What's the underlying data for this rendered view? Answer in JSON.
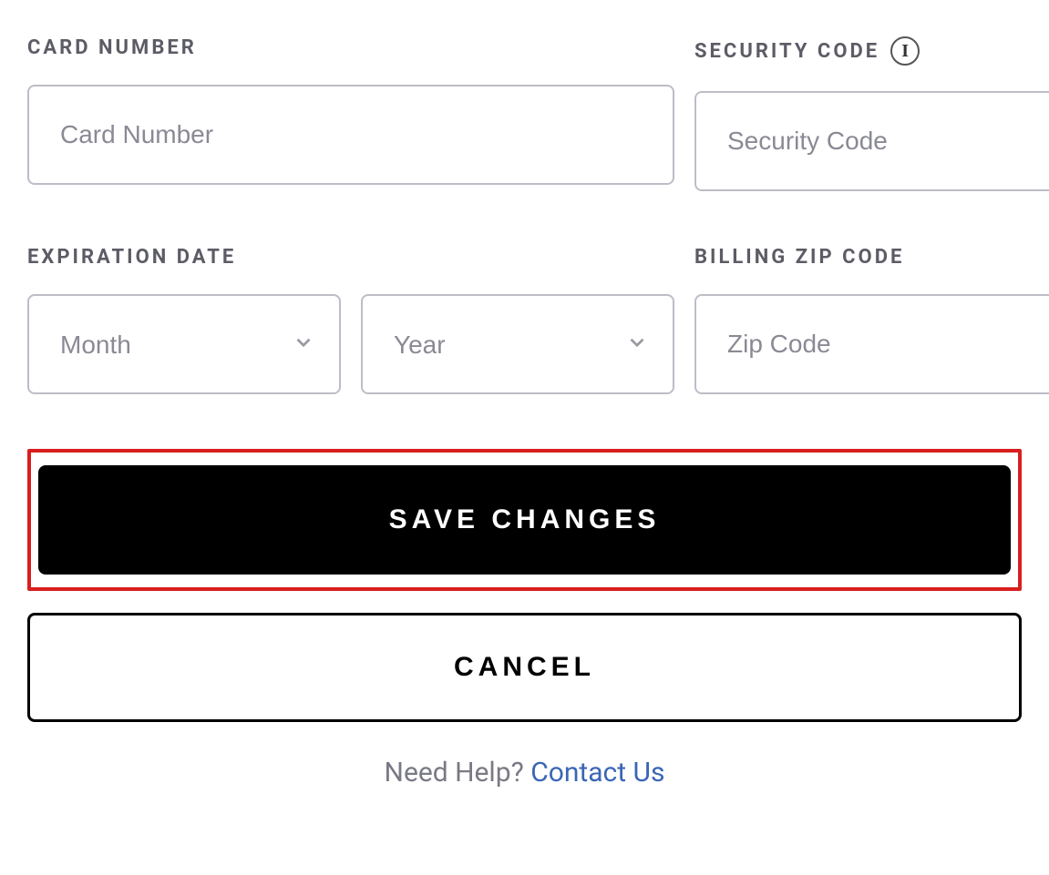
{
  "fields": {
    "card_number": {
      "label": "CARD NUMBER",
      "placeholder": "Card Number",
      "value": ""
    },
    "security_code": {
      "label": "SECURITY CODE",
      "placeholder": "Security Code",
      "value": ""
    },
    "expiration": {
      "label": "EXPIRATION DATE",
      "month_placeholder": "Month",
      "year_placeholder": "Year"
    },
    "zip": {
      "label": "BILLING ZIP CODE",
      "placeholder": "Zip Code",
      "value": ""
    }
  },
  "buttons": {
    "save": "SAVE CHANGES",
    "cancel": "CANCEL"
  },
  "help": {
    "prefix": "Need Help? ",
    "link": "Contact Us"
  }
}
